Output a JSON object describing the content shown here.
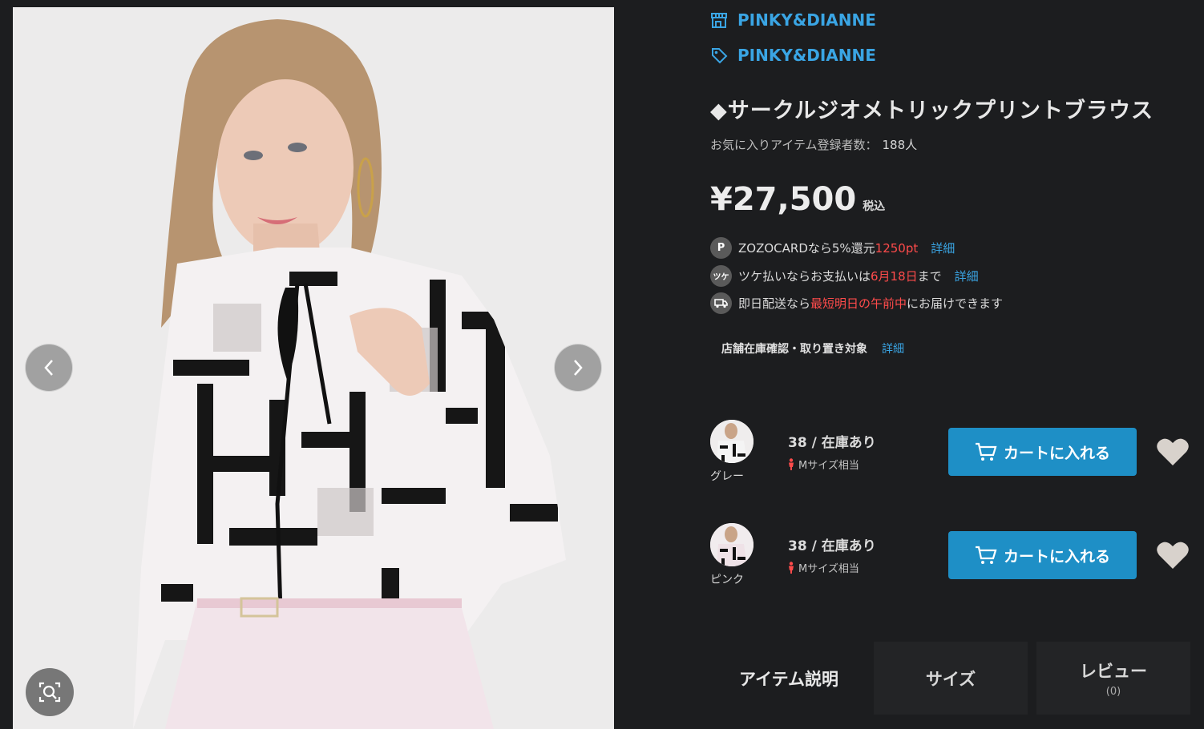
{
  "brand_shop": "PINKY&DIANNE",
  "brand_tag": "PINKY&DIANNE",
  "title": "◆サークルジオメトリックプリントブラウス",
  "favorites": {
    "label": "お気に入りアイテム登録者数：",
    "count": "188人"
  },
  "price": {
    "amount": "¥27,500",
    "tax": "税込"
  },
  "perks": [
    {
      "icon": "P",
      "text_a": "ZOZOCARDなら5%還元",
      "highlight": "1250pt",
      "text_b": "",
      "link": "詳細"
    },
    {
      "icon": "ツケ",
      "text_a": "ツケ払いならお支払いは",
      "highlight": "6月18日",
      "text_b": "まで",
      "link": "詳細"
    },
    {
      "icon": "truck-icon",
      "text_a": "即日配送なら",
      "highlight": "最短明日の午前中",
      "text_b": "にお届けできます",
      "link": ""
    }
  ],
  "store": {
    "text": "店舗在庫確認・取り置き対象",
    "link": "詳細"
  },
  "variants": [
    {
      "color": "グレー",
      "stock": "38 / 在庫あり",
      "fit": "Mサイズ相当",
      "cart": "カートに入れる"
    },
    {
      "color": "ピンク",
      "stock": "38 / 在庫あり",
      "fit": "Mサイズ相当",
      "cart": "カートに入れる"
    }
  ],
  "tabs": {
    "description": "アイテム説明",
    "size": "サイズ",
    "review": "レビュー",
    "review_count": "(0)"
  },
  "colors": {
    "accent": "#3aa5e4",
    "cart": "#1e8fc6",
    "highlight": "#ff4b4b",
    "background": "#1c1d1f"
  }
}
